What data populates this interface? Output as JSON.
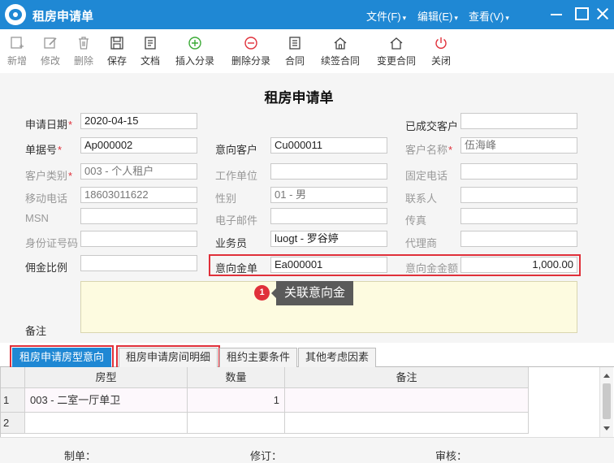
{
  "window": {
    "title": "租房申请单",
    "menus": [
      "文件(F)",
      "编辑(E)",
      "查看(V)"
    ],
    "colors": {
      "accent": "#1f88d4",
      "highlight": "#e0303a"
    }
  },
  "toolbar": {
    "new": "新增",
    "edit": "修改",
    "delete": "删除",
    "save": "保存",
    "document": "文档",
    "insert_entry": "插入分录",
    "delete_entry": "删除分录",
    "contract": "合同",
    "renew_contract": "续签合同",
    "change_contract": "变更合同",
    "close": "关闭"
  },
  "form": {
    "title": "租房申请单",
    "apply_date": {
      "label": "申请日期",
      "value": "2020-04-15"
    },
    "doc_no": {
      "label": "单据号",
      "value": "Ap000002"
    },
    "customer_type": {
      "label": "客户类别",
      "value": "003 - 个人租户"
    },
    "mobile": {
      "label": "移动电话",
      "value": "18603011622"
    },
    "msn": {
      "label": "MSN",
      "value": ""
    },
    "id_no": {
      "label": "身份证号码",
      "value": ""
    },
    "commission_ratio": {
      "label": "佣金比例",
      "value": ""
    },
    "intended_customer": {
      "label": "意向客户",
      "value": "Cu000011"
    },
    "work_unit": {
      "label": "工作单位",
      "value": ""
    },
    "gender": {
      "label": "性别",
      "value": "01 - 男"
    },
    "email": {
      "label": "电子邮件",
      "value": ""
    },
    "salesman": {
      "label": "业务员",
      "value": "luogt  - 罗谷婷"
    },
    "deposit_doc": {
      "label": "意向金单",
      "value": "Ea000001"
    },
    "closed_customer": {
      "label": "已成交客户",
      "value": ""
    },
    "customer_name": {
      "label": "客户名称",
      "value": "伍海峰"
    },
    "landline": {
      "label": "固定电话",
      "value": ""
    },
    "contact": {
      "label": "联系人",
      "value": ""
    },
    "fax": {
      "label": "传真",
      "value": ""
    },
    "agent": {
      "label": "代理商",
      "value": ""
    },
    "deposit_amount": {
      "label": "意向金金额",
      "value": "1,000.00"
    },
    "remarks": {
      "label": "备注",
      "value": ""
    }
  },
  "callout": {
    "number": "1",
    "text": "关联意向金"
  },
  "tabs": [
    "租房申请房型意向",
    "租房申请房间明细",
    "租约主要条件",
    "其他考虑因素"
  ],
  "grid": {
    "columns": [
      "房型",
      "数量",
      "备注"
    ],
    "rows": [
      {
        "num": "1",
        "room_type": "003 - 二室一厅单卫",
        "qty": "1",
        "note": ""
      },
      {
        "num": "2",
        "room_type": "",
        "qty": "",
        "note": ""
      }
    ]
  },
  "footer": {
    "maker": "制单：",
    "revise": "修订：",
    "audit": "审核："
  }
}
